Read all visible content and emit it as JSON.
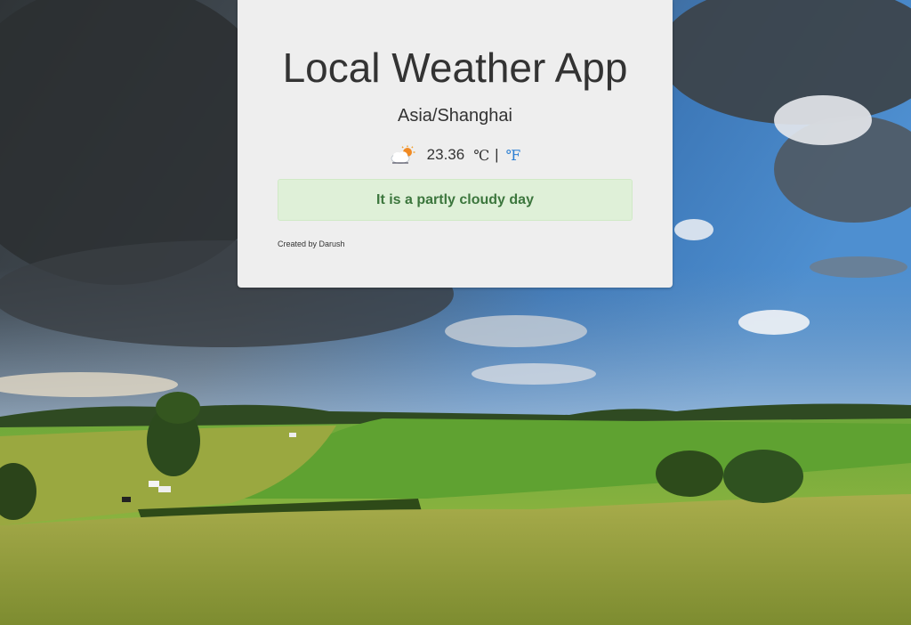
{
  "app": {
    "title": "Local Weather App",
    "location": "Asia/Shanghai",
    "weather_icon": "partly-cloudy-icon",
    "temperature": "23.36",
    "unit_celsius": "℃",
    "unit_separator": "|",
    "unit_fahrenheit": "℉",
    "condition_message": "It is a partly cloudy day",
    "credit": "Created by Darush"
  },
  "colors": {
    "card_background": "#eeeeee",
    "alert_background": "#dff0d8",
    "alert_text": "#3c763d",
    "link": "#2a7ed3"
  }
}
